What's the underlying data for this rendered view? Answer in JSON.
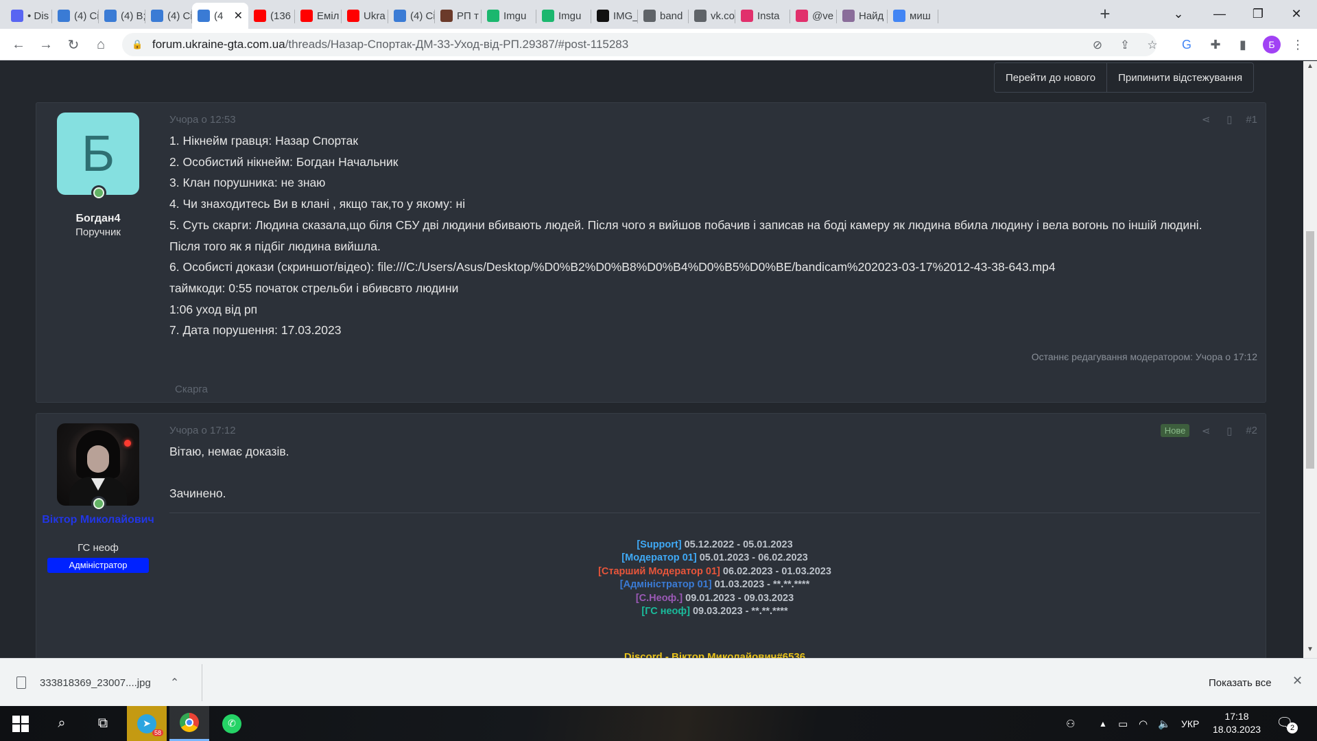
{
  "browser": {
    "tabs": [
      {
        "title": "• Dis",
        "icon": "discord-icon",
        "color": "#5865f2"
      },
      {
        "title": "(4) Ci",
        "icon": "ukraine-gta-icon",
        "color": "#3a7bd5"
      },
      {
        "title": "(4) В;",
        "icon": "ukraine-gta-icon",
        "color": "#3a7bd5"
      },
      {
        "title": "(4) Ci",
        "icon": "ukraine-gta-icon",
        "color": "#3a7bd5"
      },
      {
        "title": "(4",
        "icon": "ukraine-gta-icon",
        "color": "#3a7bd5",
        "active": true
      },
      {
        "title": "(136",
        "icon": "youtube-icon",
        "color": "#ff0000"
      },
      {
        "title": "Еміл",
        "icon": "youtube-icon",
        "color": "#ff0000"
      },
      {
        "title": "Ukra",
        "icon": "youtube-icon",
        "color": "#ff0000"
      },
      {
        "title": "(4) Ci",
        "icon": "ukraine-gta-icon",
        "color": "#3a7bd5"
      },
      {
        "title": "РП т",
        "icon": "game-icon",
        "color": "#6b3a2a"
      },
      {
        "title": "Imgu",
        "icon": "imgur-icon",
        "color": "#1bb76e"
      },
      {
        "title": "Imgu",
        "icon": "imgur-icon",
        "color": "#1bb76e"
      },
      {
        "title": "IMG_",
        "icon": "v-icon",
        "color": "#111111"
      },
      {
        "title": "band",
        "icon": "globe-icon",
        "color": "#5f6368"
      },
      {
        "title": "vk.co",
        "icon": "vk-icon",
        "color": "#5f6368"
      },
      {
        "title": "Insta",
        "icon": "instagram-icon",
        "color": "#e1306c"
      },
      {
        "title": "@ve",
        "icon": "instagram-icon",
        "color": "#e1306c"
      },
      {
        "title": "Найд",
        "icon": "puzzle-icon",
        "color": "#8a6d9a"
      },
      {
        "title": "миш",
        "icon": "google-icon",
        "color": "#4285f4"
      }
    ],
    "url_host": "forum.ukraine-gta.com.ua",
    "url_path": "/threads/Назар-Спортак-ДМ-33-Уход-від-РП.29387/#post-115283",
    "profile_letter": "Б"
  },
  "thread_buttons": {
    "go_new": "Перейти до нового",
    "unwatch": "Припинити відстежування"
  },
  "posts": [
    {
      "avatar_letter": "Б",
      "avatar_color": "#85e0e0",
      "username": "Богдан4",
      "username_color": "#f0f0f0",
      "user_title": "Поручник",
      "date": "Учора о 12:53",
      "number": "#1",
      "lines": [
        "1. Нікнейм гравця: Назар Спортак",
        "2. Особистий нікнейм: Богдан Начальник",
        "3. Клан порушника: не знаю",
        "4. Чи знаходитесь Ви в клані , якщо так,то у якому: ні",
        "5. Суть скарги: Людина сказала,що біля СБУ дві людини вбивають людей. Після чого я вийшов побачив і записав на боді камеру як людина вбила людину і вела вогонь по іншій людині.",
        "Після того як я підбіг людина вийшла.",
        "6. Особисті докази (скриншот/відео): file:///C:/Users/Asus/Desktop/%D0%B2%D0%B8%D0%B4%D0%B5%D0%BE/bandicam%202023-03-17%2012-43-38-643.mp4",
        "таймкоди: 0:55 початок стрельби і вбивсвто людини",
        "1:06 уход від рп",
        "7. Дата порушення: 17.03.2023"
      ],
      "edited": "Останнє редагування модератором: Учора о 17:12",
      "report": "Скарга"
    },
    {
      "username": "Віктор Миколайович",
      "username_color": "#2236e6",
      "user_title": "ГС неоф",
      "user_badge": "Адміністратор",
      "date": "Учора о 17:12",
      "number": "#2",
      "new_badge": "Нове",
      "lines": [
        "Вітаю, немає доказів.",
        "",
        "Зачинено."
      ],
      "signature": [
        {
          "role": "[Support]",
          "dates": "05.12.2022 - 05.01.2023",
          "color": "#3fa9f5"
        },
        {
          "role": "[Модератор 01]",
          "dates": "05.01.2023 - 06.02.2023",
          "color": "#3fa9f5"
        },
        {
          "role": "[Старший Модератор 01]",
          "dates": "06.02.2023 - 01.03.2023",
          "color": "#e8553a"
        },
        {
          "role": "[Адміністратор 01]",
          "dates": "01.03.2023 - **.**.****",
          "color": "#3a7bd5"
        },
        {
          "role": "[С.Неоф.]",
          "dates": "09.01.2023 - 09.03.2023",
          "color": "#9b59b6"
        },
        {
          "role": "[ГС неоф]",
          "dates": "09.03.2023 - **.**.****",
          "color": "#1abc9c"
        }
      ],
      "discord": "Discord - Віктор Миколайович#6536"
    }
  ],
  "downloads": {
    "file": "333818369_23007....jpg",
    "show_all": "Показать все"
  },
  "taskbar": {
    "telegram_count": "58",
    "language": "УКР",
    "time": "17:18",
    "date": "18.03.2023",
    "notifications": "2"
  }
}
